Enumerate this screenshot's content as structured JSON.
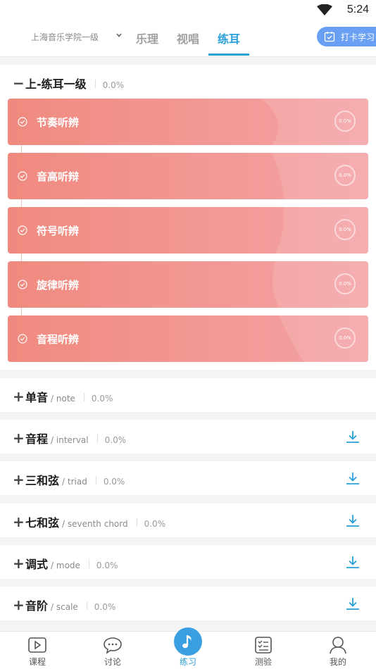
{
  "status": {
    "time": "5:24"
  },
  "header": {
    "school": "上海音乐学院一级",
    "tabs": [
      {
        "label": "乐理",
        "active": false
      },
      {
        "label": "视唱",
        "active": false
      },
      {
        "label": "练耳",
        "active": true
      }
    ],
    "checkin_label": "打卡学习"
  },
  "expanded_section": {
    "title": "上-练耳一级",
    "percent": "0.0%",
    "items": [
      {
        "label": "节奏听辨",
        "percent": "0.0%"
      },
      {
        "label": "音高听辩",
        "percent": "0.0%"
      },
      {
        "label": "符号听辨",
        "percent": "0.0%"
      },
      {
        "label": "旋律听辨",
        "percent": "0.0%"
      },
      {
        "label": "音程听辨",
        "percent": "0.0%"
      }
    ]
  },
  "sections": [
    {
      "title": "单音",
      "en": "/ note",
      "percent": "0.0%",
      "download": false
    },
    {
      "title": "音程",
      "en": "/ interval",
      "percent": "0.0%",
      "download": true
    },
    {
      "title": "三和弦",
      "en": "/ triad",
      "percent": "0.0%",
      "download": true
    },
    {
      "title": "七和弦",
      "en": "/ seventh chord",
      "percent": "0.0%",
      "download": true
    },
    {
      "title": "调式",
      "en": "/ mode",
      "percent": "0.0%",
      "download": true
    },
    {
      "title": "音阶",
      "en": "/ scale",
      "percent": "0.0%",
      "download": true
    }
  ],
  "nav": [
    {
      "label": "课程",
      "icon": "play-video-icon"
    },
    {
      "label": "讨论",
      "icon": "chat-bubble-icon"
    },
    {
      "label": "练习",
      "icon": "music-note-icon",
      "active": true
    },
    {
      "label": "测验",
      "icon": "checklist-icon"
    },
    {
      "label": "我的",
      "icon": "user-icon"
    }
  ],
  "colors": {
    "accent": "#2aa0d8",
    "card_start": "#f08a7f",
    "card_end": "#f4a3a6",
    "checkin": "#6aa0f3"
  }
}
